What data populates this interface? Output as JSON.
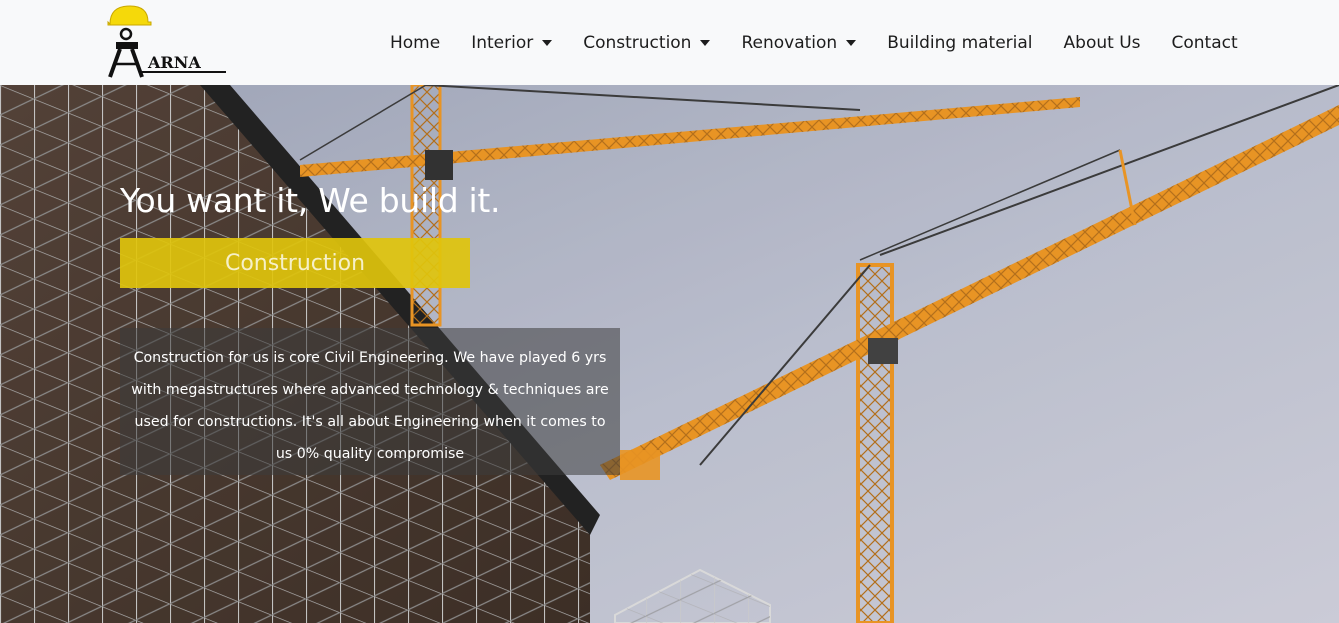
{
  "brand": {
    "logo_text": "ARNA"
  },
  "nav": {
    "items": [
      {
        "label": "Home",
        "dropdown": false
      },
      {
        "label": "Interior",
        "dropdown": true
      },
      {
        "label": "Construction",
        "dropdown": true
      },
      {
        "label": "Renovation",
        "dropdown": true
      },
      {
        "label": "Building material",
        "dropdown": false
      },
      {
        "label": "About Us",
        "dropdown": false
      },
      {
        "label": "Contact",
        "dropdown": false
      }
    ]
  },
  "hero": {
    "title": "You want it, We build it.",
    "badge": "Construction",
    "description": "Construction for us is core Civil Engineering. We have played 6 yrs with megastructures where advanced technology & techniques are used for constructions. It's all about Engineering when it comes to us 0% quality compromise"
  },
  "colors": {
    "navbar_bg": "#f8f9fa",
    "accent_yellow": "#e0c40c",
    "crane_orange": "#e8901c",
    "sky": "#b8bccb"
  }
}
